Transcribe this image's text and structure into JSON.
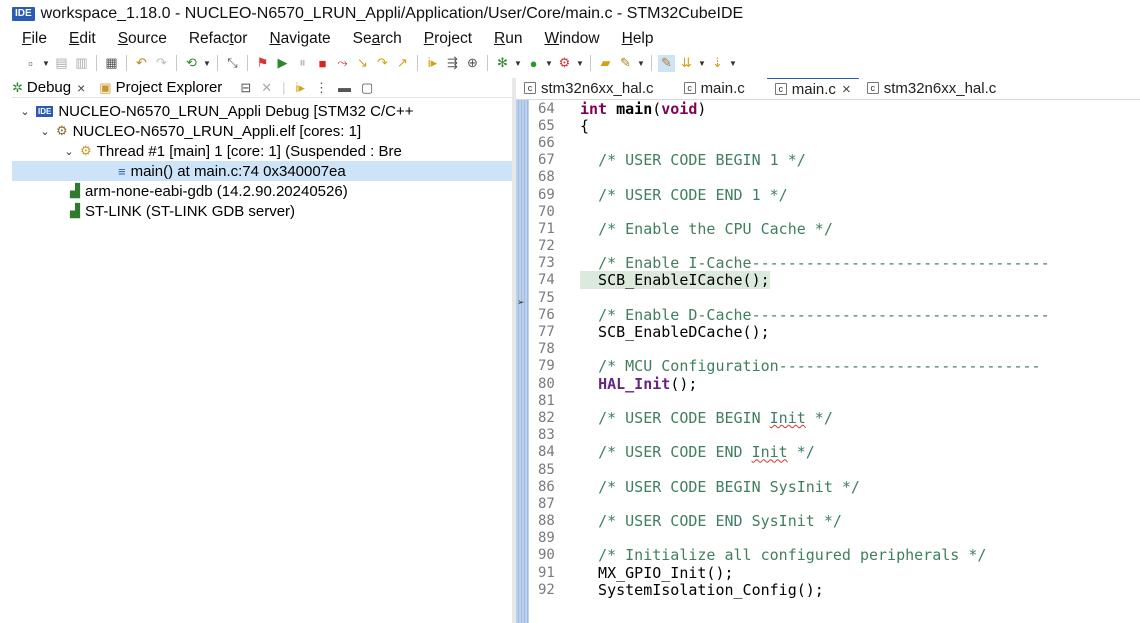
{
  "window": {
    "badge": "IDE",
    "title": "workspace_1.18.0 - NUCLEO-N6570_LRUN_Appli/Application/User/Core/main.c - STM32CubeIDE"
  },
  "menu": [
    {
      "label": "File",
      "mn": "F",
      "rest": "ile"
    },
    {
      "label": "Edit",
      "mn": "E",
      "rest": "dit"
    },
    {
      "label": "Source",
      "mn": "S",
      "rest": "ource"
    },
    {
      "label": "Refactor",
      "pre": "Refac",
      "mn": "t",
      "rest": "or"
    },
    {
      "label": "Navigate",
      "mn": "N",
      "rest": "avigate"
    },
    {
      "label": "Search",
      "pre": "Se",
      "mn": "a",
      "rest": "rch"
    },
    {
      "label": "Project",
      "mn": "P",
      "rest": "roject"
    },
    {
      "label": "Run",
      "mn": "R",
      "rest": "un"
    },
    {
      "label": "Window",
      "mn": "W",
      "rest": "indow"
    },
    {
      "label": "Help",
      "mn": "H",
      "rest": "elp"
    }
  ],
  "left_panel": {
    "tabs": [
      {
        "label": "Debug",
        "icon": "debug-icon",
        "closable": "×"
      },
      {
        "label": "Project Explorer",
        "icon": "project-explorer-icon"
      }
    ],
    "tree": [
      {
        "text": "NUCLEO-N6570_LRUN_Appli Debug [STM32 C/C++",
        "icon": "ide-launch-icon"
      },
      {
        "text": "NUCLEO-N6570_LRUN_Appli.elf [cores: 1]",
        "icon": "process-icon"
      },
      {
        "text": "Thread #1 [main] 1 [core: 1] (Suspended : Bre",
        "icon": "thread-icon"
      },
      {
        "text": "main() at main.c:74 0x340007ea",
        "icon": "stack-frame-icon"
      },
      {
        "text": "arm-none-eabi-gdb (14.2.90.20240526)",
        "icon": "gdb-icon"
      },
      {
        "text": "ST-LINK (ST-LINK GDB server)",
        "icon": "stlink-icon"
      }
    ]
  },
  "editor": {
    "tabs": [
      {
        "label": "stm32n6xx_hal.c",
        "active": false
      },
      {
        "label": "main.c",
        "active": false
      },
      {
        "label": "main.c",
        "active": true,
        "close": "×"
      },
      {
        "label": "stm32n6xx_hal.c",
        "active": false
      }
    ],
    "current_line": 74,
    "lines": [
      {
        "n": "64",
        "t": "int main(void)"
      },
      {
        "n": "65",
        "t": "{"
      },
      {
        "n": "66",
        "t": ""
      },
      {
        "n": "67",
        "t": "  /* USER CODE BEGIN 1 */"
      },
      {
        "n": "68",
        "t": ""
      },
      {
        "n": "69",
        "t": "  /* USER CODE END 1 */"
      },
      {
        "n": "70",
        "t": ""
      },
      {
        "n": "71",
        "t": "  /* Enable the CPU Cache */"
      },
      {
        "n": "72",
        "t": ""
      },
      {
        "n": "73",
        "t": "  /* Enable I-Cache---------------------------------"
      },
      {
        "n": "74",
        "t": "  SCB_EnableICache();"
      },
      {
        "n": "75",
        "t": ""
      },
      {
        "n": "76",
        "t": "  /* Enable D-Cache---------------------------------"
      },
      {
        "n": "77",
        "t": "  SCB_EnableDCache();"
      },
      {
        "n": "78",
        "t": ""
      },
      {
        "n": "79",
        "t": "  /* MCU Configuration-----------------------------"
      },
      {
        "n": "80",
        "t": "  HAL_Init();"
      },
      {
        "n": "81",
        "t": ""
      },
      {
        "n": "82",
        "t": "  /* USER CODE BEGIN Init */"
      },
      {
        "n": "83",
        "t": ""
      },
      {
        "n": "84",
        "t": "  /* USER CODE END Init */"
      },
      {
        "n": "85",
        "t": ""
      },
      {
        "n": "86",
        "t": "  /* USER CODE BEGIN SysInit */"
      },
      {
        "n": "87",
        "t": ""
      },
      {
        "n": "88",
        "t": "  /* USER CODE END SysInit */"
      },
      {
        "n": "89",
        "t": ""
      },
      {
        "n": "90",
        "t": "  /* Initialize all configured peripherals */"
      },
      {
        "n": "91",
        "t": "  MX_GPIO_Init();"
      },
      {
        "n": "92",
        "t": "  SystemIsolation_Config();"
      }
    ]
  },
  "colors": {
    "comment": "#3f7f5f",
    "keyword": "#7f0055",
    "current_line_bg": "#dceadb",
    "selection_bg": "#cde3f7"
  }
}
